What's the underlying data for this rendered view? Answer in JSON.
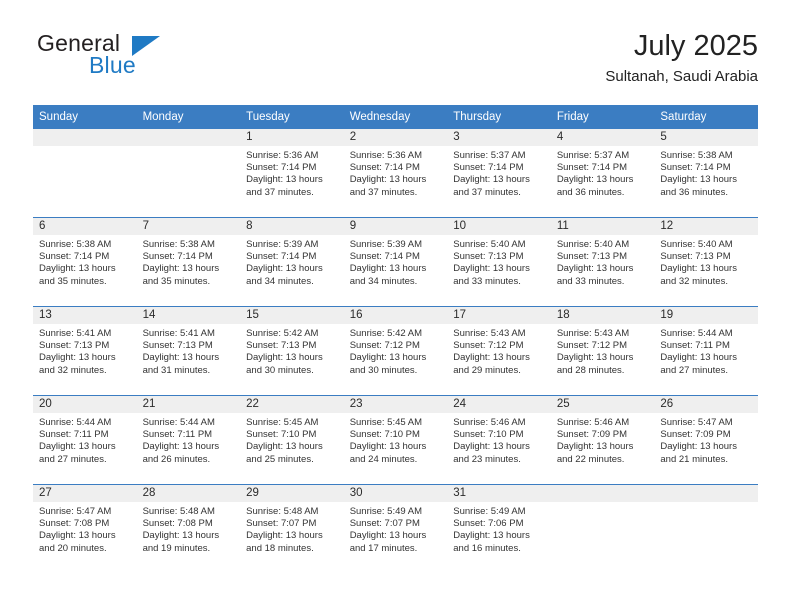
{
  "brand": {
    "name_top": "General",
    "name_bottom": "Blue",
    "accent_color": "#1f7ac4",
    "logo_icon": "triangle-icon"
  },
  "header": {
    "title": "July 2025",
    "location": "Sultanah, Saudi Arabia"
  },
  "theme": {
    "header_blue": "#3b7dc2",
    "daynum_band": "#efefef",
    "text": "#333333"
  },
  "calendar": {
    "weekday_headers": [
      "Sunday",
      "Monday",
      "Tuesday",
      "Wednesday",
      "Thursday",
      "Friday",
      "Saturday"
    ],
    "weeks": [
      [
        {
          "day": "",
          "sunrise": "",
          "sunset": "",
          "daylight_line1": "",
          "daylight_line2": "",
          "empty": true
        },
        {
          "day": "",
          "sunrise": "",
          "sunset": "",
          "daylight_line1": "",
          "daylight_line2": "",
          "empty": true
        },
        {
          "day": "1",
          "sunrise": "Sunrise: 5:36 AM",
          "sunset": "Sunset: 7:14 PM",
          "daylight_line1": "Daylight: 13 hours",
          "daylight_line2": "and 37 minutes."
        },
        {
          "day": "2",
          "sunrise": "Sunrise: 5:36 AM",
          "sunset": "Sunset: 7:14 PM",
          "daylight_line1": "Daylight: 13 hours",
          "daylight_line2": "and 37 minutes."
        },
        {
          "day": "3",
          "sunrise": "Sunrise: 5:37 AM",
          "sunset": "Sunset: 7:14 PM",
          "daylight_line1": "Daylight: 13 hours",
          "daylight_line2": "and 37 minutes."
        },
        {
          "day": "4",
          "sunrise": "Sunrise: 5:37 AM",
          "sunset": "Sunset: 7:14 PM",
          "daylight_line1": "Daylight: 13 hours",
          "daylight_line2": "and 36 minutes."
        },
        {
          "day": "5",
          "sunrise": "Sunrise: 5:38 AM",
          "sunset": "Sunset: 7:14 PM",
          "daylight_line1": "Daylight: 13 hours",
          "daylight_line2": "and 36 minutes."
        }
      ],
      [
        {
          "day": "6",
          "sunrise": "Sunrise: 5:38 AM",
          "sunset": "Sunset: 7:14 PM",
          "daylight_line1": "Daylight: 13 hours",
          "daylight_line2": "and 35 minutes."
        },
        {
          "day": "7",
          "sunrise": "Sunrise: 5:38 AM",
          "sunset": "Sunset: 7:14 PM",
          "daylight_line1": "Daylight: 13 hours",
          "daylight_line2": "and 35 minutes."
        },
        {
          "day": "8",
          "sunrise": "Sunrise: 5:39 AM",
          "sunset": "Sunset: 7:14 PM",
          "daylight_line1": "Daylight: 13 hours",
          "daylight_line2": "and 34 minutes."
        },
        {
          "day": "9",
          "sunrise": "Sunrise: 5:39 AM",
          "sunset": "Sunset: 7:14 PM",
          "daylight_line1": "Daylight: 13 hours",
          "daylight_line2": "and 34 minutes."
        },
        {
          "day": "10",
          "sunrise": "Sunrise: 5:40 AM",
          "sunset": "Sunset: 7:13 PM",
          "daylight_line1": "Daylight: 13 hours",
          "daylight_line2": "and 33 minutes."
        },
        {
          "day": "11",
          "sunrise": "Sunrise: 5:40 AM",
          "sunset": "Sunset: 7:13 PM",
          "daylight_line1": "Daylight: 13 hours",
          "daylight_line2": "and 33 minutes."
        },
        {
          "day": "12",
          "sunrise": "Sunrise: 5:40 AM",
          "sunset": "Sunset: 7:13 PM",
          "daylight_line1": "Daylight: 13 hours",
          "daylight_line2": "and 32 minutes."
        }
      ],
      [
        {
          "day": "13",
          "sunrise": "Sunrise: 5:41 AM",
          "sunset": "Sunset: 7:13 PM",
          "daylight_line1": "Daylight: 13 hours",
          "daylight_line2": "and 32 minutes."
        },
        {
          "day": "14",
          "sunrise": "Sunrise: 5:41 AM",
          "sunset": "Sunset: 7:13 PM",
          "daylight_line1": "Daylight: 13 hours",
          "daylight_line2": "and 31 minutes."
        },
        {
          "day": "15",
          "sunrise": "Sunrise: 5:42 AM",
          "sunset": "Sunset: 7:13 PM",
          "daylight_line1": "Daylight: 13 hours",
          "daylight_line2": "and 30 minutes."
        },
        {
          "day": "16",
          "sunrise": "Sunrise: 5:42 AM",
          "sunset": "Sunset: 7:12 PM",
          "daylight_line1": "Daylight: 13 hours",
          "daylight_line2": "and 30 minutes."
        },
        {
          "day": "17",
          "sunrise": "Sunrise: 5:43 AM",
          "sunset": "Sunset: 7:12 PM",
          "daylight_line1": "Daylight: 13 hours",
          "daylight_line2": "and 29 minutes."
        },
        {
          "day": "18",
          "sunrise": "Sunrise: 5:43 AM",
          "sunset": "Sunset: 7:12 PM",
          "daylight_line1": "Daylight: 13 hours",
          "daylight_line2": "and 28 minutes."
        },
        {
          "day": "19",
          "sunrise": "Sunrise: 5:44 AM",
          "sunset": "Sunset: 7:11 PM",
          "daylight_line1": "Daylight: 13 hours",
          "daylight_line2": "and 27 minutes."
        }
      ],
      [
        {
          "day": "20",
          "sunrise": "Sunrise: 5:44 AM",
          "sunset": "Sunset: 7:11 PM",
          "daylight_line1": "Daylight: 13 hours",
          "daylight_line2": "and 27 minutes."
        },
        {
          "day": "21",
          "sunrise": "Sunrise: 5:44 AM",
          "sunset": "Sunset: 7:11 PM",
          "daylight_line1": "Daylight: 13 hours",
          "daylight_line2": "and 26 minutes."
        },
        {
          "day": "22",
          "sunrise": "Sunrise: 5:45 AM",
          "sunset": "Sunset: 7:10 PM",
          "daylight_line1": "Daylight: 13 hours",
          "daylight_line2": "and 25 minutes."
        },
        {
          "day": "23",
          "sunrise": "Sunrise: 5:45 AM",
          "sunset": "Sunset: 7:10 PM",
          "daylight_line1": "Daylight: 13 hours",
          "daylight_line2": "and 24 minutes."
        },
        {
          "day": "24",
          "sunrise": "Sunrise: 5:46 AM",
          "sunset": "Sunset: 7:10 PM",
          "daylight_line1": "Daylight: 13 hours",
          "daylight_line2": "and 23 minutes."
        },
        {
          "day": "25",
          "sunrise": "Sunrise: 5:46 AM",
          "sunset": "Sunset: 7:09 PM",
          "daylight_line1": "Daylight: 13 hours",
          "daylight_line2": "and 22 minutes."
        },
        {
          "day": "26",
          "sunrise": "Sunrise: 5:47 AM",
          "sunset": "Sunset: 7:09 PM",
          "daylight_line1": "Daylight: 13 hours",
          "daylight_line2": "and 21 minutes."
        }
      ],
      [
        {
          "day": "27",
          "sunrise": "Sunrise: 5:47 AM",
          "sunset": "Sunset: 7:08 PM",
          "daylight_line1": "Daylight: 13 hours",
          "daylight_line2": "and 20 minutes."
        },
        {
          "day": "28",
          "sunrise": "Sunrise: 5:48 AM",
          "sunset": "Sunset: 7:08 PM",
          "daylight_line1": "Daylight: 13 hours",
          "daylight_line2": "and 19 minutes."
        },
        {
          "day": "29",
          "sunrise": "Sunrise: 5:48 AM",
          "sunset": "Sunset: 7:07 PM",
          "daylight_line1": "Daylight: 13 hours",
          "daylight_line2": "and 18 minutes."
        },
        {
          "day": "30",
          "sunrise": "Sunrise: 5:49 AM",
          "sunset": "Sunset: 7:07 PM",
          "daylight_line1": "Daylight: 13 hours",
          "daylight_line2": "and 17 minutes."
        },
        {
          "day": "31",
          "sunrise": "Sunrise: 5:49 AM",
          "sunset": "Sunset: 7:06 PM",
          "daylight_line1": "Daylight: 13 hours",
          "daylight_line2": "and 16 minutes."
        },
        {
          "day": "",
          "sunrise": "",
          "sunset": "",
          "daylight_line1": "",
          "daylight_line2": "",
          "empty": true
        },
        {
          "day": "",
          "sunrise": "",
          "sunset": "",
          "daylight_line1": "",
          "daylight_line2": "",
          "empty": true
        }
      ]
    ]
  }
}
